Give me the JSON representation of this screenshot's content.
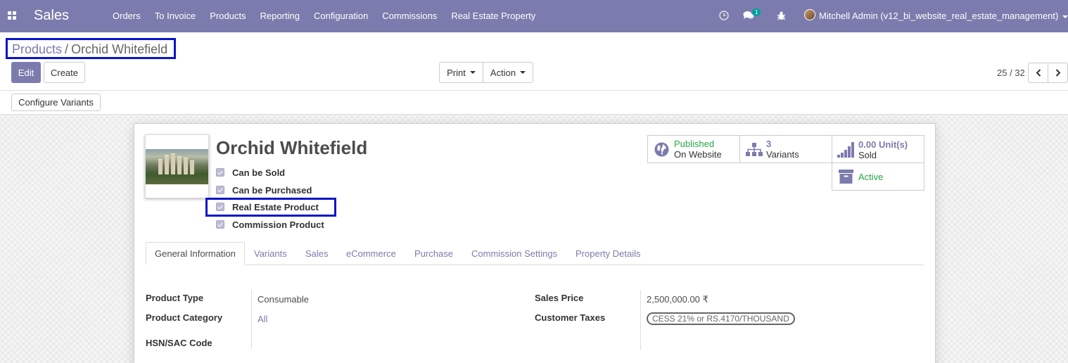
{
  "navbar": {
    "app_name": "Sales",
    "menu": [
      "Orders",
      "To Invoice",
      "Products",
      "Reporting",
      "Configuration",
      "Commissions",
      "Real Estate Property"
    ],
    "messages_count": "1",
    "user": "Mitchell Admin (v12_bi_website_real_estate_management)",
    "color": "#7c7bad"
  },
  "breadcrumb": {
    "parent": "Products",
    "separator": "/",
    "current": "Orchid Whitefield"
  },
  "buttons": {
    "edit": "Edit",
    "create": "Create",
    "print": "Print",
    "action": "Action",
    "configure_variants": "Configure Variants"
  },
  "pager": {
    "value": "25 / 32"
  },
  "product": {
    "name": "Orchid Whitefield",
    "checkboxes": [
      {
        "label": "Can be Sold",
        "checked": true
      },
      {
        "label": "Can be Purchased",
        "checked": true
      },
      {
        "label": "Real Estate Product",
        "checked": true
      },
      {
        "label": "Commission Product",
        "checked": true
      }
    ]
  },
  "smart_buttons": {
    "published": {
      "line1": "Published",
      "line2": "On Website",
      "icon": "globe-icon"
    },
    "variants": {
      "count": "3",
      "label": "Variants",
      "icon": "sitemap-icon"
    },
    "sold": {
      "value": "0.00",
      "unit": "Unit(s)",
      "label": "Sold",
      "icon": "signal-icon"
    },
    "active": {
      "label": "Active",
      "icon": "archive-icon"
    }
  },
  "tabs": [
    "General Information",
    "Variants",
    "Sales",
    "eCommerce",
    "Purchase",
    "Commission Settings",
    "Property Details"
  ],
  "general_info": {
    "left": [
      {
        "label": "Product Type",
        "value": "Consumable"
      },
      {
        "label": "Product Category",
        "value": "All"
      },
      {
        "label": "HSN/SAC Code",
        "value": ""
      }
    ],
    "right": [
      {
        "label": "Sales Price",
        "value": "2,500,000.00 ₹"
      },
      {
        "label": "Customer Taxes",
        "value": "CESS 21% or RS.4170/THOUSAND"
      }
    ]
  },
  "colors": {
    "primary": "#7c7bad",
    "success": "#28a745",
    "highlight": "#0a15c8"
  }
}
